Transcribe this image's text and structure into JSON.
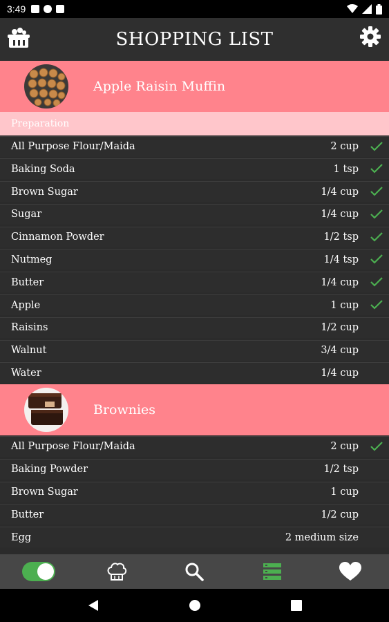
{
  "status_bar": {
    "time": "3:49"
  },
  "app_bar": {
    "title": "SHOPPING LIST",
    "left_icon": "basket-icon",
    "right_icon": "settings-icon"
  },
  "colors": {
    "accent": "#ff838c",
    "section": "#ffc6cb",
    "check": "#4caf50",
    "row_bg": "#2d2d2d",
    "nav_bg": "#474747"
  },
  "recipes": [
    {
      "title": "Apple Raisin Muffin",
      "section_label": "Preparation",
      "items": [
        {
          "name": "All Purpose Flour/Maida",
          "qty": "2 cup",
          "checked": true
        },
        {
          "name": "Baking Soda",
          "qty": "1 tsp",
          "checked": true
        },
        {
          "name": "Brown Sugar",
          "qty": "1/4 cup",
          "checked": true
        },
        {
          "name": "Sugar",
          "qty": "1/4 cup",
          "checked": true
        },
        {
          "name": "Cinnamon Powder",
          "qty": "1/2 tsp",
          "checked": true
        },
        {
          "name": "Nutmeg",
          "qty": "1/4 tsp",
          "checked": true
        },
        {
          "name": "Butter",
          "qty": "1/4 cup",
          "checked": true
        },
        {
          "name": "Apple",
          "qty": "1 cup",
          "checked": true
        },
        {
          "name": "Raisins",
          "qty": "1/2 cup",
          "checked": false
        },
        {
          "name": "Walnut",
          "qty": "3/4 cup",
          "checked": false
        },
        {
          "name": "Water",
          "qty": "1/4 cup",
          "checked": false
        }
      ]
    },
    {
      "title": "Brownies",
      "items": [
        {
          "name": "All Purpose Flour/Maida",
          "qty": "2 cup",
          "checked": true
        },
        {
          "name": "Baking Powder",
          "qty": "1/2 tsp",
          "checked": false
        },
        {
          "name": "Brown Sugar",
          "qty": "1 cup",
          "checked": false
        },
        {
          "name": "Butter",
          "qty": "1/2 cup",
          "checked": false
        },
        {
          "name": "Egg",
          "qty": "2 medium size",
          "checked": false
        }
      ]
    }
  ],
  "bottom_nav": [
    {
      "icon": "toggle-switch",
      "state": "on"
    },
    {
      "icon": "chef-hat-icon"
    },
    {
      "icon": "search-icon"
    },
    {
      "icon": "list-icon",
      "active": true
    },
    {
      "icon": "heart-icon"
    }
  ]
}
